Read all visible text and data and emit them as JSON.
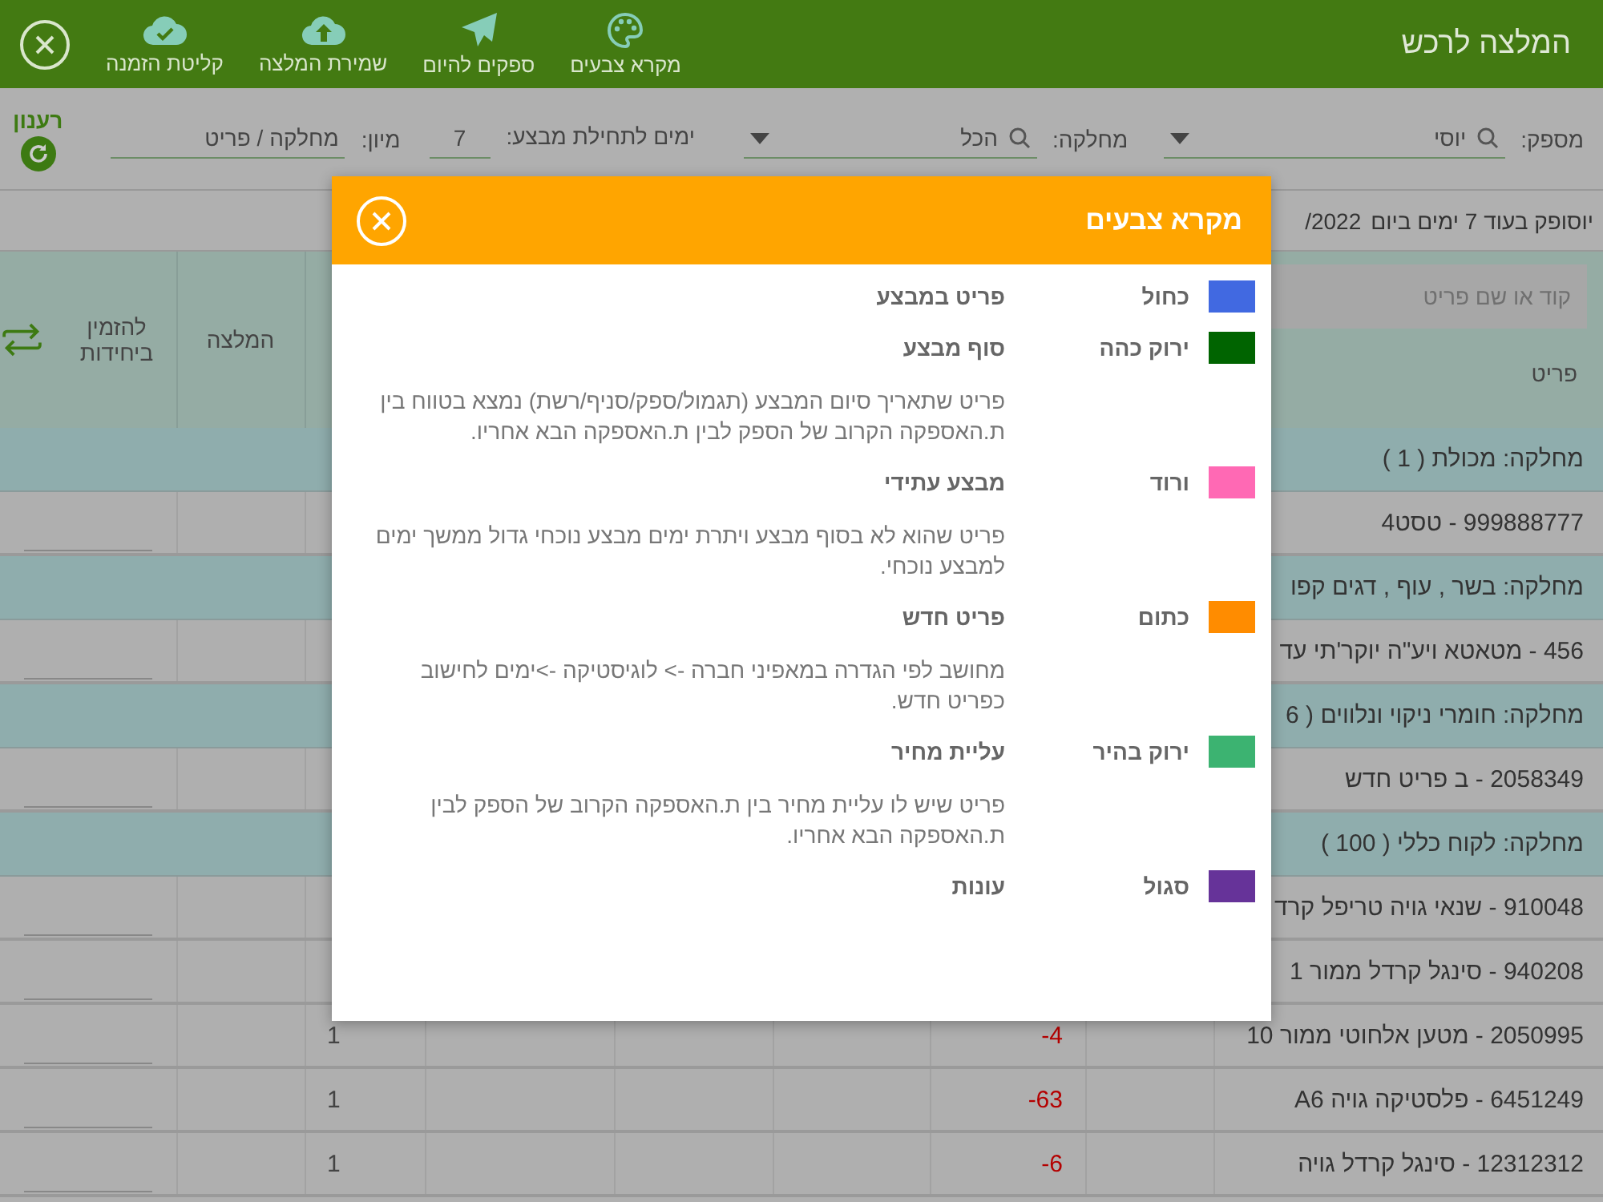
{
  "header": {
    "title": "המלצה לרכש",
    "toolbar": [
      {
        "kind": "palette",
        "label": "מקרא צבעים"
      },
      {
        "kind": "send",
        "label": "ספקים להיום"
      },
      {
        "kind": "upload",
        "label": "שמירת המלצה"
      },
      {
        "kind": "check",
        "label": "קליטת הזמנה"
      }
    ]
  },
  "filters": {
    "supplier": {
      "label": "מספק:",
      "value": "יוסי"
    },
    "department": {
      "label": "מחלקה:",
      "value": "הכל"
    },
    "days": {
      "label": "ימים לתחילת מבצע:",
      "value": "7"
    },
    "sort": {
      "label": "מיון:",
      "value": "מחלקה / פריט"
    },
    "refresh": {
      "label": "רענון"
    }
  },
  "delivery_note": {
    "text": "יוסופק בעוד 7 ימים ביום",
    "date": "/2022"
  },
  "table": {
    "item_search": {
      "placeholder": "קוד או שם פריט"
    },
    "columns": [
      {
        "label": "פריט"
      },
      {
        "label": "המלצה"
      },
      {
        "label": "להזמין ביחידות"
      }
    ],
    "rows": [
      {
        "kind": "group",
        "label": "מחלקה: מכולת  ( 1 )"
      },
      {
        "kind": "item",
        "name": "999888777 - טסט4"
      },
      {
        "kind": "group",
        "label": "מחלקה: בשר , עוף , דגים קפו"
      },
      {
        "kind": "item",
        "name": "456 - מטאטא ויע\"ה יוקר'תי עד"
      },
      {
        "kind": "group",
        "label": "מחלקה: חומרי ניקוי ונלווים  ( 6"
      },
      {
        "kind": "item",
        "name": "2058349 - ב פריט חדש"
      },
      {
        "kind": "group",
        "label": "מחלקה: לקוח כללי  ( 100 )"
      },
      {
        "kind": "item",
        "name": "910048 - שנאי גויה טריפל קרד"
      },
      {
        "kind": "item",
        "name": "940208 - סינגל קרדל ממור 1"
      },
      {
        "kind": "item",
        "name": "2050995 - מטען אלחוטי ממור 10",
        "balance": "-4",
        "quantity": "1"
      },
      {
        "kind": "item",
        "name": "6451249 - פלסטיקה גויה A6",
        "balance": "-63",
        "quantity": "1"
      },
      {
        "kind": "item",
        "name": "12312312 - סינגל קרדל גויה",
        "balance": "-6",
        "quantity": "1"
      }
    ]
  },
  "legend_dialog": {
    "title": "מקרא צבעים",
    "entries": [
      {
        "color": "#4169e1",
        "name": "כחול",
        "title": "פריט במבצע"
      },
      {
        "color": "#006400",
        "name": "ירוק כהה",
        "title": "סוף מבצע",
        "description": "פריט שתאריך סיום המבצע (תגמול/ספק/סניף/רשת) נמצא בטווח בין ת.האספקה הקרוב של הספק לבין ת.האספקה הבא אחריו."
      },
      {
        "color": "#ff69b4",
        "name": "ורוד",
        "title": "מבצע עתידי",
        "description": "פריט שהוא לא בסוף מבצע ויתרת ימים מבצע נוכחי גדול ממשך ימים למבצע נוכחי."
      },
      {
        "color": "#ff8c00",
        "name": "כתום",
        "title": "פריט חדש",
        "description": "מחושב לפי הגדרה במאפיני חברה -> לוגיסטיקה ->ימים לחישוב כפריט חדש."
      },
      {
        "color": "#3cb371",
        "name": "ירוק בהיר",
        "title": "עליית מחיר",
        "description": "פריט שיש לו עליית מחיר בין ת.האספקה הקרוב של הספק לבין ת.האספקה הבא אחריו."
      },
      {
        "color": "#663399",
        "name": "סגול",
        "title": "עונות"
      }
    ]
  }
}
